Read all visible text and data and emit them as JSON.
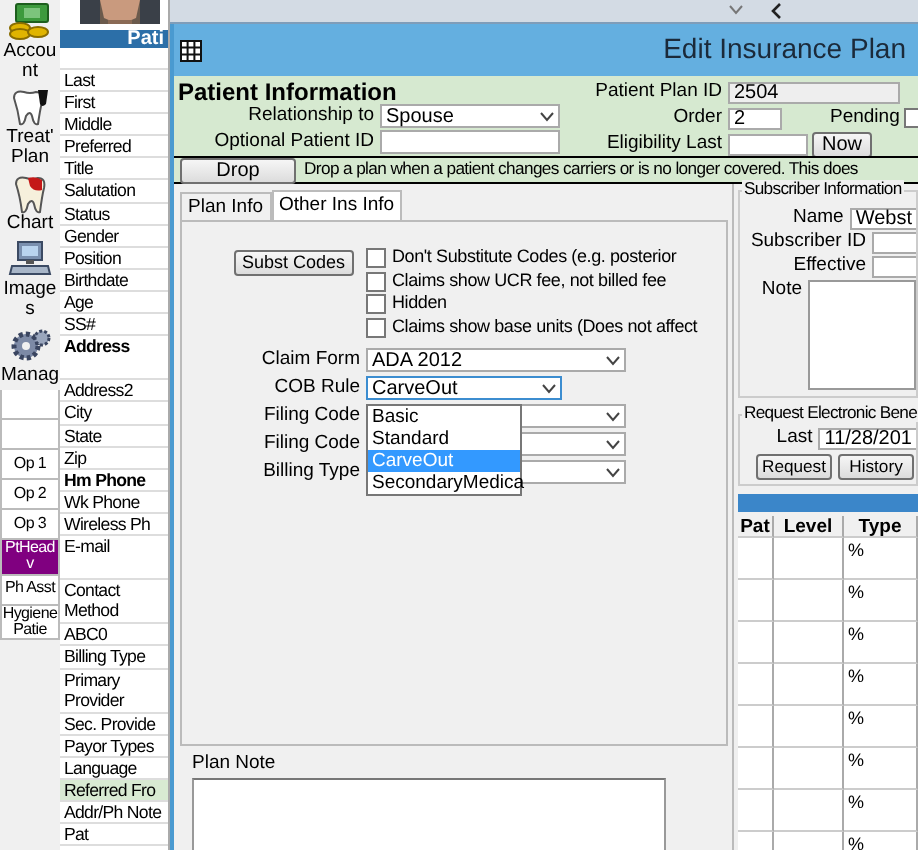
{
  "toolbar": [
    {
      "label": "Account",
      "kind": "money"
    },
    {
      "label": "Treat' Plan",
      "kind": "tooth_plan"
    },
    {
      "label": "Chart",
      "kind": "tooth"
    },
    {
      "label": "Images",
      "kind": "computer"
    },
    {
      "label": "Manag",
      "kind": "gears"
    }
  ],
  "operatories": [
    {
      "kind": "blank",
      "color": "#ffffff"
    },
    {
      "kind": "blank",
      "color": "#ffffff"
    },
    {
      "kind": "op",
      "label": "Op 1",
      "color": "#ffffff"
    },
    {
      "kind": "op",
      "label": "Op 2",
      "color": "#ffffff"
    },
    {
      "kind": "op",
      "label": "Op 3",
      "color": "#ffffff"
    },
    {
      "kind": "op",
      "label": "PtHead v",
      "color": "#800080"
    },
    {
      "kind": "op",
      "label": "Ph Asst",
      "color": "#ffffff"
    },
    {
      "kind": "op",
      "label": "Hygiene Patie",
      "color": "#ffffff"
    }
  ],
  "patient_panel": {
    "header": "Pati",
    "fields": [
      {
        "label": "Last",
        "bold": false,
        "highlighted": false,
        "kind": "line"
      },
      {
        "label": "First",
        "bold": false,
        "highlighted": false,
        "kind": "line"
      },
      {
        "label": "Middle",
        "bold": false,
        "highlighted": false,
        "kind": "line"
      },
      {
        "label": "Preferred",
        "bold": false,
        "highlighted": false,
        "kind": "line"
      },
      {
        "label": "Title",
        "bold": false,
        "highlighted": false,
        "kind": "line"
      },
      {
        "label": "Salutation",
        "bold": false,
        "highlighted": false,
        "kind": "line"
      },
      {
        "label": "Status",
        "bold": false,
        "highlighted": false,
        "kind": "line"
      },
      {
        "label": "Gender",
        "bold": false,
        "highlighted": false,
        "kind": "line"
      },
      {
        "label": "Position",
        "bold": false,
        "highlighted": false,
        "kind": "line"
      },
      {
        "label": "Birthdate",
        "bold": false,
        "highlighted": false,
        "kind": "line"
      },
      {
        "label": "Age",
        "bold": false,
        "highlighted": false,
        "kind": "line"
      },
      {
        "label": "SS#",
        "bold": false,
        "highlighted": false,
        "kind": "line"
      },
      {
        "label": "Address",
        "bold": true,
        "highlighted": false,
        "kind": "multiline"
      },
      {
        "label": "Address2",
        "bold": false,
        "highlighted": false,
        "kind": "line"
      },
      {
        "label": "City",
        "bold": false,
        "highlighted": false,
        "kind": "line"
      },
      {
        "label": "State",
        "bold": false,
        "highlighted": false,
        "kind": "line"
      },
      {
        "label": "Zip",
        "bold": false,
        "highlighted": false,
        "kind": "line"
      },
      {
        "label": "Hm Phone",
        "bold": true,
        "highlighted": false,
        "kind": "line"
      },
      {
        "label": "Wk Phone",
        "bold": false,
        "highlighted": false,
        "kind": "line"
      },
      {
        "label": "Wireless Ph",
        "bold": false,
        "highlighted": false,
        "kind": "line"
      },
      {
        "label": "E-mail",
        "bold": false,
        "highlighted": false,
        "kind": "multiline"
      },
      {
        "label": "Contact Method",
        "bold": false,
        "highlighted": false,
        "kind": "multiline"
      },
      {
        "label": "ABC0",
        "bold": false,
        "highlighted": false,
        "kind": "line"
      },
      {
        "label": "Billing Type",
        "bold": false,
        "highlighted": false,
        "kind": "line"
      },
      {
        "label": "Primary Provider",
        "bold": false,
        "highlighted": false,
        "kind": "multiline"
      },
      {
        "label": "Sec. Provide",
        "bold": false,
        "highlighted": false,
        "kind": "line"
      },
      {
        "label": "Payor Types",
        "bold": false,
        "highlighted": false,
        "kind": "line"
      },
      {
        "label": "Language",
        "bold": false,
        "highlighted": false,
        "kind": "line"
      },
      {
        "label": "Referred Fro",
        "bold": false,
        "highlighted": true,
        "kind": "line"
      },
      {
        "label": "Addr/Ph Note",
        "bold": false,
        "highlighted": false,
        "kind": "line"
      },
      {
        "label": "Pat",
        "bold": false,
        "highlighted": false,
        "kind": "line"
      }
    ]
  },
  "dialog": {
    "title": "Edit Insurance Plan",
    "patient_info": {
      "heading": "Patient Information",
      "relationship_label": "Relationship to",
      "relationship": "Spouse",
      "optional_id_label": "Optional Patient ID",
      "plan_id_label": "Patient Plan ID",
      "plan_id": "2504",
      "order_label": "Order",
      "order": "2",
      "pending_label": "Pending",
      "pending_checked": false,
      "eligibility_label": "Eligibility Last",
      "now_button": "Now"
    },
    "drop": {
      "button": "Drop",
      "text": "Drop a plan when a patient changes carriers or is no longer covered.  This does"
    },
    "tabs": [
      {
        "label": "Plan Info",
        "selected": false
      },
      {
        "label": "Other Ins Info",
        "selected": true
      }
    ],
    "other_ins": {
      "subst_button": "Subst Codes",
      "checkboxes": [
        {
          "label": "Don't Substitute Codes (e.g. posterior",
          "checked": false
        },
        {
          "label": "Claims show UCR fee, not billed fee",
          "checked": false
        },
        {
          "label": "Hidden",
          "checked": false
        },
        {
          "label": "Claims show base units (Does not affect",
          "checked": false
        }
      ],
      "fields": [
        {
          "label": "Claim Form",
          "value": "ADA 2012",
          "open": false
        },
        {
          "label": "COB Rule",
          "value": "CarveOut",
          "open": true
        },
        {
          "label": "Filing Code",
          "open": false
        },
        {
          "label": "Filing Code",
          "open": false
        },
        {
          "label": "Billing Type",
          "open": false
        }
      ],
      "cob_options": [
        {
          "label": "Basic",
          "selected": false
        },
        {
          "label": "Standard",
          "selected": false
        },
        {
          "label": "CarveOut",
          "selected": true
        },
        {
          "label": "SecondaryMedica",
          "selected": false
        }
      ]
    },
    "plan_note_label": "Plan Note",
    "subscriber": {
      "legend": "Subscriber Information",
      "name_label": "Name",
      "name": "Webst",
      "id_label": "Subscriber ID",
      "effective_label": "Effective",
      "note_label": "Note"
    },
    "benefit_request": {
      "legend": "Request Electronic Bene",
      "last_label": "Last",
      "last": "11/28/201",
      "buttons": [
        "Request",
        "History"
      ]
    },
    "benefits_table": {
      "columns": [
        "Pat",
        "Level",
        "Type"
      ],
      "rows": [
        {
          "type": "%"
        },
        {
          "type": "%"
        },
        {
          "type": "%"
        },
        {
          "type": "%"
        },
        {
          "type": "%"
        },
        {
          "type": "%"
        },
        {
          "type": "%"
        },
        {
          "type": "%"
        }
      ]
    }
  }
}
